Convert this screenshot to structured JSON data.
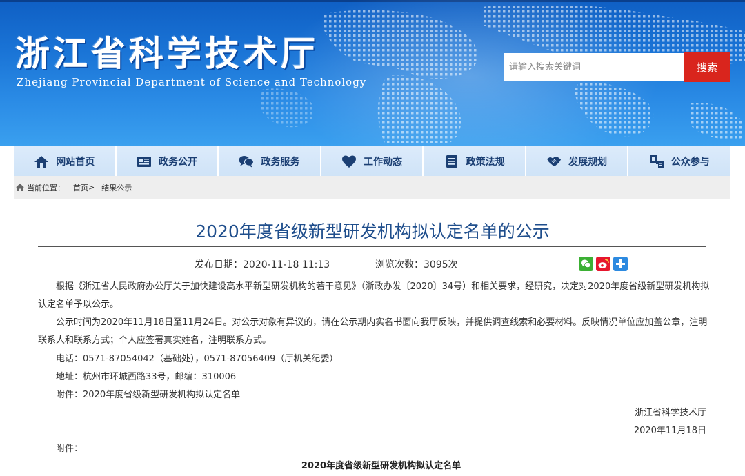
{
  "header": {
    "logo_cn": "浙江省科学技术厅",
    "logo_en": "Zhejiang Provincial Department of Science and Technology",
    "search_placeholder": "请输入搜索关键词",
    "search_button": "搜索"
  },
  "nav": {
    "items": [
      {
        "label": "网站首页",
        "icon": "home-icon"
      },
      {
        "label": "政务公开",
        "icon": "newspaper-icon"
      },
      {
        "label": "政务服务",
        "icon": "chat-bubbles-icon"
      },
      {
        "label": "工作动态",
        "icon": "heart-icon"
      },
      {
        "label": "政策法规",
        "icon": "document-list-icon"
      },
      {
        "label": "发展规划",
        "icon": "handshake-icon"
      },
      {
        "label": "公众参与",
        "icon": "participation-icon"
      }
    ]
  },
  "breadcrumb": {
    "prefix": "当前位置：",
    "home": "首页",
    "sep": ">",
    "current": "结果公示"
  },
  "article": {
    "title": "2020年度省级新型研发机构拟认定名单的公示",
    "publish_label": "发布日期：",
    "publish_date": "2020-11-18 11:13",
    "views_label": "浏览次数：",
    "views": "3095次",
    "share_icons": [
      "wechat-icon",
      "weibo-icon",
      "share-plus-icon"
    ],
    "para1": "根据《浙江省人民政府办公厅关于加快建设高水平新型研发机构的若干意见》（浙政办发〔2020〕34号）和相关要求，经研究，决定对2020年度省级新型研发机构拟认定名单予以公示。",
    "para2": "公示时间为2020年11月18日至11月24日。对公示对象有异议的，请在公示期内实名书面向我厅反映，并提供调查线索和必要材料。反映情况单位应加盖公章，注明联系人和联系方式；个人应签署真实姓名，注明联系方式。",
    "phone": "电话：0571-87054042（基础处），0571-87056409（厅机关纪委）",
    "address": "地址：杭州市环城西路33号，邮编：310006",
    "attachment": "附件：2020年度省级新型研发机构拟认定名单",
    "signature": "浙江省科学技术厅",
    "sign_date": "2020年11月18日",
    "attach_label": "附件：",
    "attach_title": "2020年度省级新型研发机构拟认定名单"
  },
  "colors": {
    "banner_blue": "#1a74d6",
    "search_red": "#d9251d",
    "nav_bg": "#d6e7f9",
    "nav_text": "#1b3f73",
    "title_blue": "#1f4e8c",
    "wechat_green": "#3cb034",
    "weibo_red": "#e6162d",
    "share_blue": "#2d8ae0"
  }
}
